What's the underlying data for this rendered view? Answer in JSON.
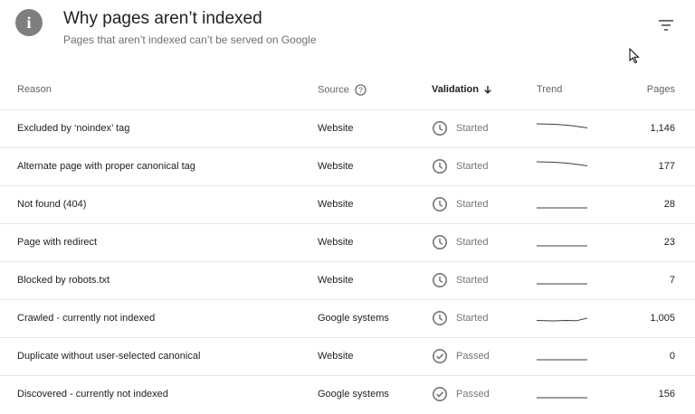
{
  "header": {
    "icon": "info-icon",
    "title": "Why pages aren’t indexed",
    "subtitle": "Pages that aren’t indexed can’t be served on Google"
  },
  "table": {
    "columns": {
      "reason": "Reason",
      "source": "Source",
      "validation": "Validation",
      "trend": "Trend",
      "pages": "Pages"
    },
    "rows": [
      {
        "reason": "Excluded by ‘noindex’ tag",
        "source": "Website",
        "validation": "Started",
        "validation_icon": "clock-icon",
        "pages": "1,146",
        "trend": "declining"
      },
      {
        "reason": "Alternate page with proper canonical tag",
        "source": "Website",
        "validation": "Started",
        "validation_icon": "clock-icon",
        "pages": "177",
        "trend": "declining"
      },
      {
        "reason": "Not found (404)",
        "source": "Website",
        "validation": "Started",
        "validation_icon": "clock-icon",
        "pages": "28",
        "trend": "flat"
      },
      {
        "reason": "Page with redirect",
        "source": "Website",
        "validation": "Started",
        "validation_icon": "clock-icon",
        "pages": "23",
        "trend": "flat"
      },
      {
        "reason": "Blocked by robots.txt",
        "source": "Website",
        "validation": "Started",
        "validation_icon": "clock-icon",
        "pages": "7",
        "trend": "flat"
      },
      {
        "reason": "Crawled - currently not indexed",
        "source": "Google systems",
        "validation": "Started",
        "validation_icon": "clock-icon",
        "pages": "1,005",
        "trend": "rising"
      },
      {
        "reason": "Duplicate without user-selected canonical",
        "source": "Website",
        "validation": "Passed",
        "validation_icon": "check-circle-icon",
        "pages": "0",
        "trend": "flat"
      },
      {
        "reason": "Discovered - currently not indexed",
        "source": "Google systems",
        "validation": "Passed",
        "validation_icon": "check-circle-icon",
        "pages": "156",
        "trend": "flat"
      }
    ]
  },
  "colors": {
    "icon_gray": "#757575",
    "text": "#202124",
    "muted": "#5f6368"
  }
}
